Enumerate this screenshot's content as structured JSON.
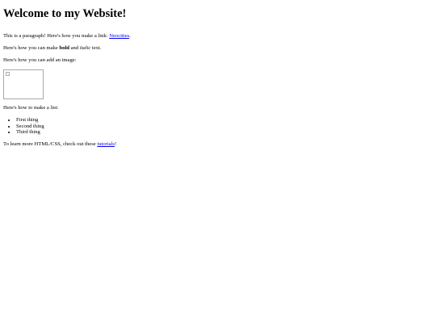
{
  "heading": "Welcome to my Website!",
  "para1": {
    "before": "This is a paragraph! Here's how you make a link: ",
    "link": "Neocities",
    "after": "."
  },
  "para2": {
    "before": "Here's how you can make ",
    "bold": "bold",
    "middle": " and ",
    "italic": "italic",
    "after": " text."
  },
  "para3": "Here's how you can add an image:",
  "para4": "Here's how to make a list:",
  "list": [
    "First thing",
    "Second thing",
    "Third thing"
  ],
  "para5": {
    "before": "To learn more HTML/CSS, check out these ",
    "link": "tutorials",
    "after": "!"
  }
}
